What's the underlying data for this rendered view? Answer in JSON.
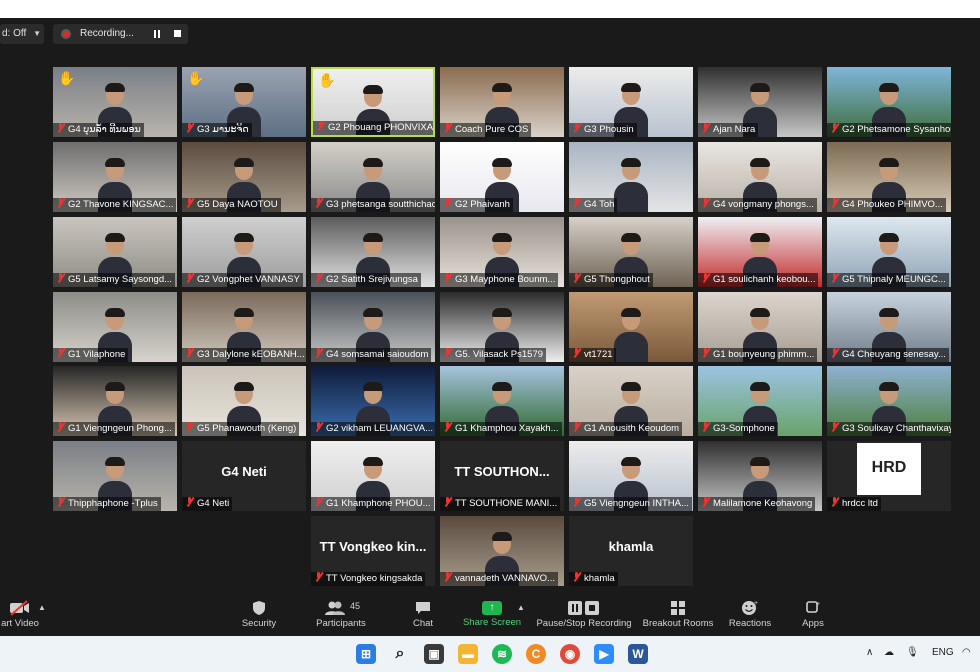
{
  "topbar": {
    "cc_label": "d: Off",
    "recording_label": "Recording..."
  },
  "participants": [
    {
      "name": "G4 ບຸນລ້ຳ ທີນພອນ",
      "hand": true
    },
    {
      "name": "G3 ມານະຈິດ",
      "hand": true
    },
    {
      "name": "G2 Phouang PHONVIXAY",
      "hand": true,
      "active": true
    },
    {
      "name": "Coach Pure COS"
    },
    {
      "name": "G3 Phousin"
    },
    {
      "name": "Ajan Nara"
    },
    {
      "name": "G2 Phetsamone Sysanhou..."
    },
    {
      "name": "G2 Thavone KINGSAC..."
    },
    {
      "name": "G5 Daya NAOTOU"
    },
    {
      "name": "G3 phetsanga soutthichack"
    },
    {
      "name": "G2 Phaivanh"
    },
    {
      "name": "G4 Toh"
    },
    {
      "name": "G4 vongmany phongs..."
    },
    {
      "name": "G4 Phoukeo PHIMVO..."
    },
    {
      "name": "G5 Latsamy Saysongd..."
    },
    {
      "name": "G2 Vongphet VANNASY"
    },
    {
      "name": "G2 Satith  Srejivungsa"
    },
    {
      "name": "G3 Mayphone Bounm..."
    },
    {
      "name": "G5 Thongphout"
    },
    {
      "name": "G1 soulichanh keobou..."
    },
    {
      "name": "G5 Thipnaly MEUNGC..."
    },
    {
      "name": "G1 Vilaphone"
    },
    {
      "name": "G3 Dalylone kEOBANH..."
    },
    {
      "name": "G4 somsamai saioudom"
    },
    {
      "name": "G5. Vilasack Ps1579"
    },
    {
      "name": "vt1721"
    },
    {
      "name": "G1 bounyeung phimm..."
    },
    {
      "name": "G4  Cheuyang senesay..."
    },
    {
      "name": "G1 Viengngeun Phong..."
    },
    {
      "name": "G5 Phanawouth (Keng)"
    },
    {
      "name": "G2 vikham LEUANGVA..."
    },
    {
      "name": "G1 Khamphou Xayakh..."
    },
    {
      "name": "G1 Anousith Keoudom"
    },
    {
      "name": "G3-Somphone"
    },
    {
      "name": "G3 Soulixay Chanthavixay"
    },
    {
      "name": "Thipphaphone -Tplus"
    },
    {
      "name": "G4 Neti",
      "big": "G4 Neti"
    },
    {
      "name": "G1 Khamphone PHOU..."
    },
    {
      "name": "TT SOUTHONE MANI...",
      "big": "TT  SOUTHON..."
    },
    {
      "name": "G5 Viengngeun INTHA..."
    },
    {
      "name": "Malilamone Keohavong"
    },
    {
      "name": "hrdcc ltd",
      "logo": "HRD"
    },
    {
      "name": "TT Vongkeo kingsakda",
      "big": "TT Vongkeo kin..."
    },
    {
      "name": "vannadeth VANNAVO..."
    },
    {
      "name": "khamla",
      "big": "khamla"
    }
  ],
  "toolbar": {
    "start_video": "art Video",
    "security": "Security",
    "participants": "Participants",
    "participant_count": "45",
    "chat": "Chat",
    "share_screen": "Share Screen",
    "pause_stop_recording": "Pause/Stop Recording",
    "breakout_rooms": "Breakout Rooms",
    "reactions": "Reactions",
    "apps": "Apps"
  },
  "taskbar": {
    "lang": "ENG"
  },
  "colors": {
    "active_border": "#b9dd48",
    "mute_red": "#e33333",
    "share_green": "#1fb650"
  }
}
